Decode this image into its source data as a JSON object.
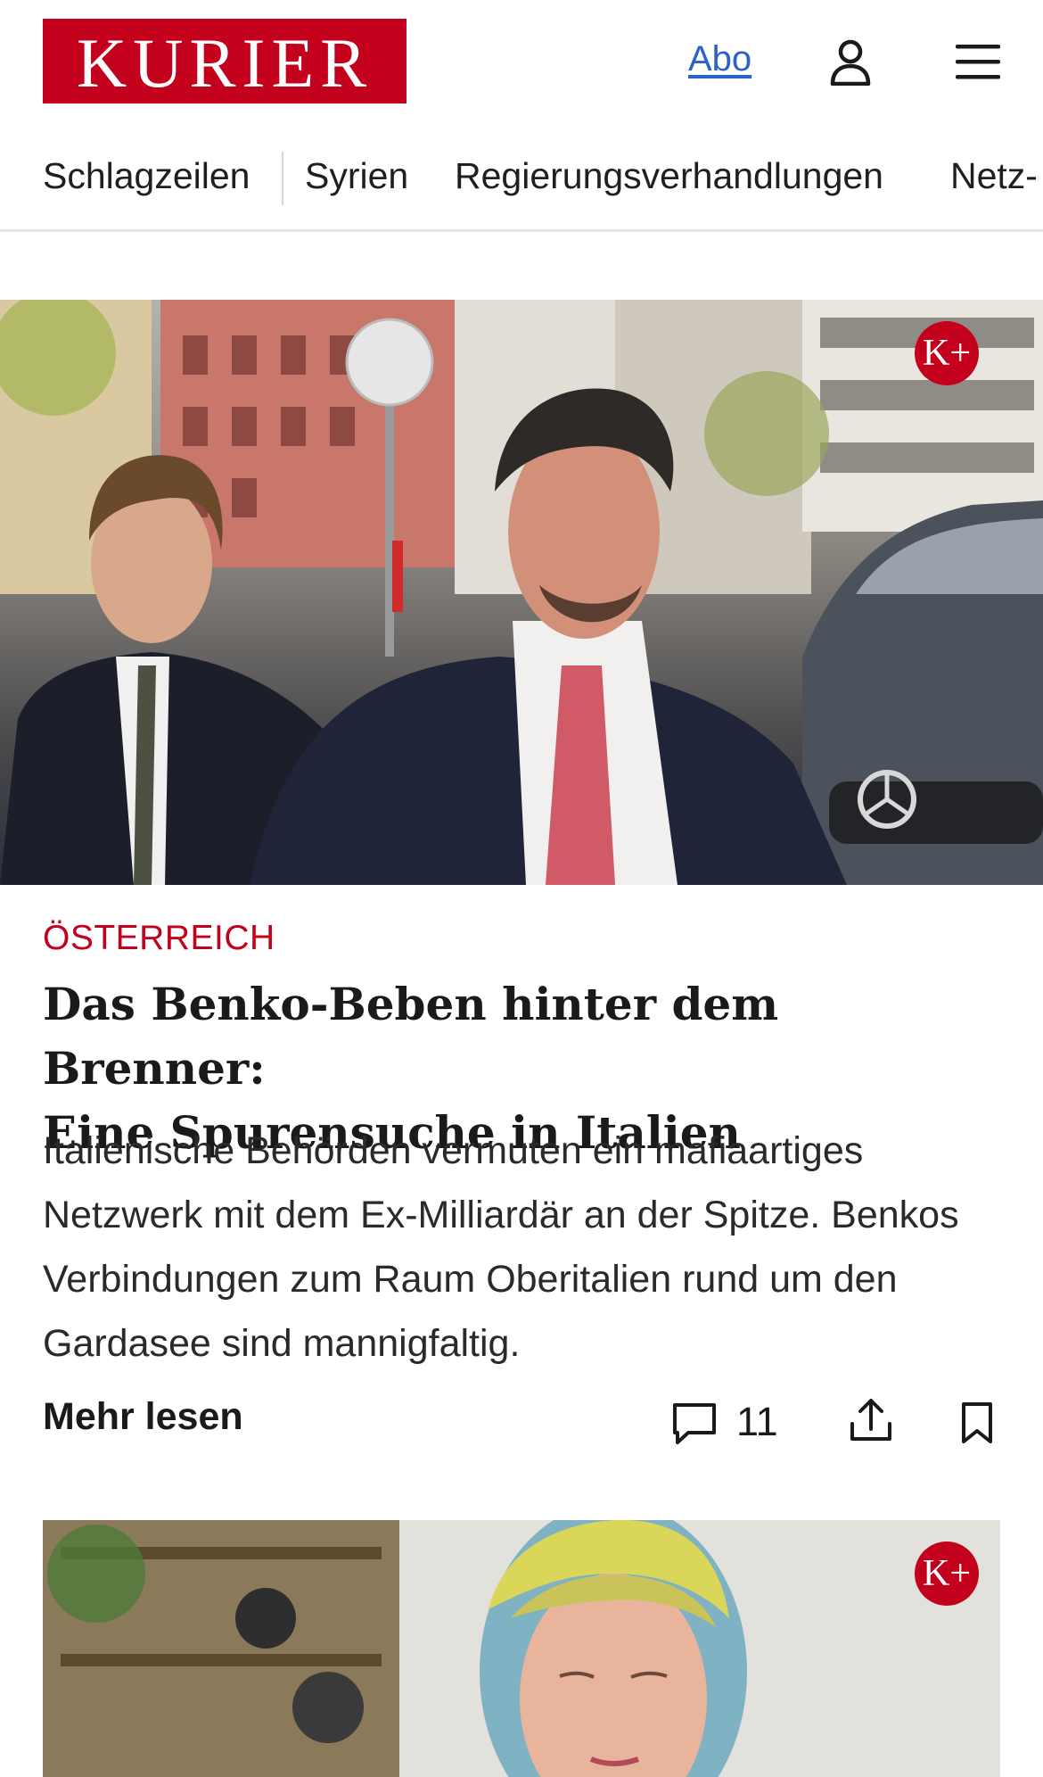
{
  "brand": {
    "logo_text": "KURIER",
    "color": "#c4011d"
  },
  "header": {
    "abo_label": "Abo"
  },
  "nav": {
    "items": [
      "Schlagzeilen",
      "Syrien",
      "Regierungsverhandlungen",
      "Netz-"
    ]
  },
  "article": {
    "badge": "K+",
    "kicker": "ÖSTERREICH",
    "headline_line1": "Das Benko-Beben hinter dem Brenner:",
    "headline_line2": "Eine Spurensuche in Italien",
    "teaser": "Italienische Behörden vermuten ein mafiaartiges Netzwerk mit dem Ex-Milliardär an der Spitze. Benkos Verbindungen zum Raum Oberitalien rund um den Gardasee sind mannigfaltig.",
    "more_label": "Mehr lesen",
    "comment_count": "11"
  },
  "second_article": {
    "badge": "K+"
  },
  "icons": {
    "user": "user-icon",
    "menu": "hamburger-menu-icon",
    "comment": "comment-icon",
    "share": "share-icon",
    "bookmark": "bookmark-icon"
  }
}
